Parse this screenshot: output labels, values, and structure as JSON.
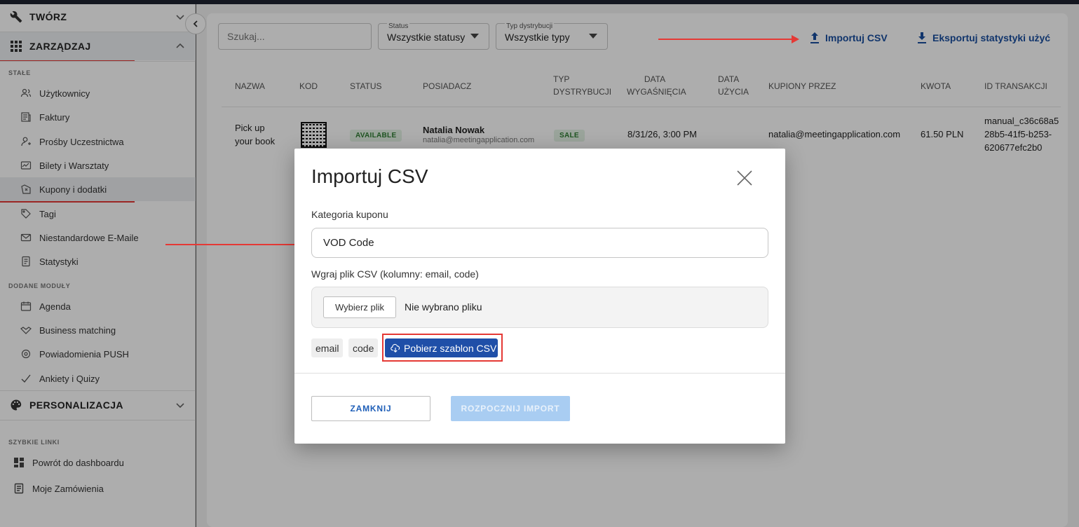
{
  "sidebar": {
    "sections": {
      "create": "TWÓRZ",
      "manage": "ZARZĄDZAJ",
      "personalize": "PERSONALIZACJA"
    },
    "groups": {
      "fixed": "STAŁE",
      "modules": "DODANE MODUŁY",
      "quick": "SZYBKIE LINKI"
    },
    "fixed_items": [
      "Użytkownicy",
      "Faktury",
      "Prośby Uczestnictwa",
      "Bilety i Warsztaty",
      "Kupony i dodatki",
      "Tagi",
      "Niestandardowe E-Maile",
      "Statystyki"
    ],
    "module_items": [
      "Agenda",
      "Business matching",
      "Powiadomienia PUSH",
      "Ankiety i Quizy"
    ],
    "quick_items": [
      "Powrót do dashboardu",
      "Moje Zamówienia"
    ]
  },
  "toolbar": {
    "search_placeholder": "Szukaj...",
    "status_label": "Status",
    "status_value": "Wszystkie statusy",
    "type_label": "Typ dystrybucji",
    "type_value": "Wszystkie typy",
    "import_label": "Importuj CSV",
    "export_label": "Eksportuj statystyki użyć"
  },
  "table": {
    "headers": {
      "name": "NAZWA",
      "code": "KOD",
      "status": "STATUS",
      "owner": "POSIADACZ",
      "type_1": "TYP",
      "type_2": "DYSTRYBUCJI",
      "exp_1": "DATA",
      "exp_2": "WYGAŚNIĘCIA",
      "used_1": "DATA",
      "used_2": "UŻYCIA",
      "bought_by": "KUPIONY PRZEZ",
      "amount": "KWOTA",
      "transaction": "ID TRANSAKCJI"
    },
    "row": {
      "name_1": "Pick up",
      "name_2": "your book",
      "status": "AVAILABLE",
      "owner_name": "Natalia Nowak",
      "owner_email": "natalia@meetingapplication.com",
      "type": "SALE",
      "expiration": "8/31/26, 3:00 PM",
      "bought_by": "natalia@meetingapplication.com",
      "amount": "61.50 PLN",
      "transaction_1": "manual_c36c68a5",
      "transaction_2": "28b5-41f5-b253-",
      "transaction_3": "620677efc2b0"
    }
  },
  "modal": {
    "title": "Importuj CSV",
    "category_label": "Kategoria kuponu",
    "category_value": "VOD Code",
    "upload_label": "Wgraj plik CSV (kolumny: email, code)",
    "file_button": "Wybierz plik",
    "file_status": "Nie wybrano pliku",
    "chip_email": "email",
    "chip_code": "code",
    "template_button": "Pobierz szablon CSV",
    "close_button": "ZAMKNIJ",
    "start_button": "ROZPOCZNIJ IMPORT"
  },
  "colors": {
    "accent": "#1f4fa8",
    "annotation": "#e53935",
    "success": "#2e7d32"
  }
}
